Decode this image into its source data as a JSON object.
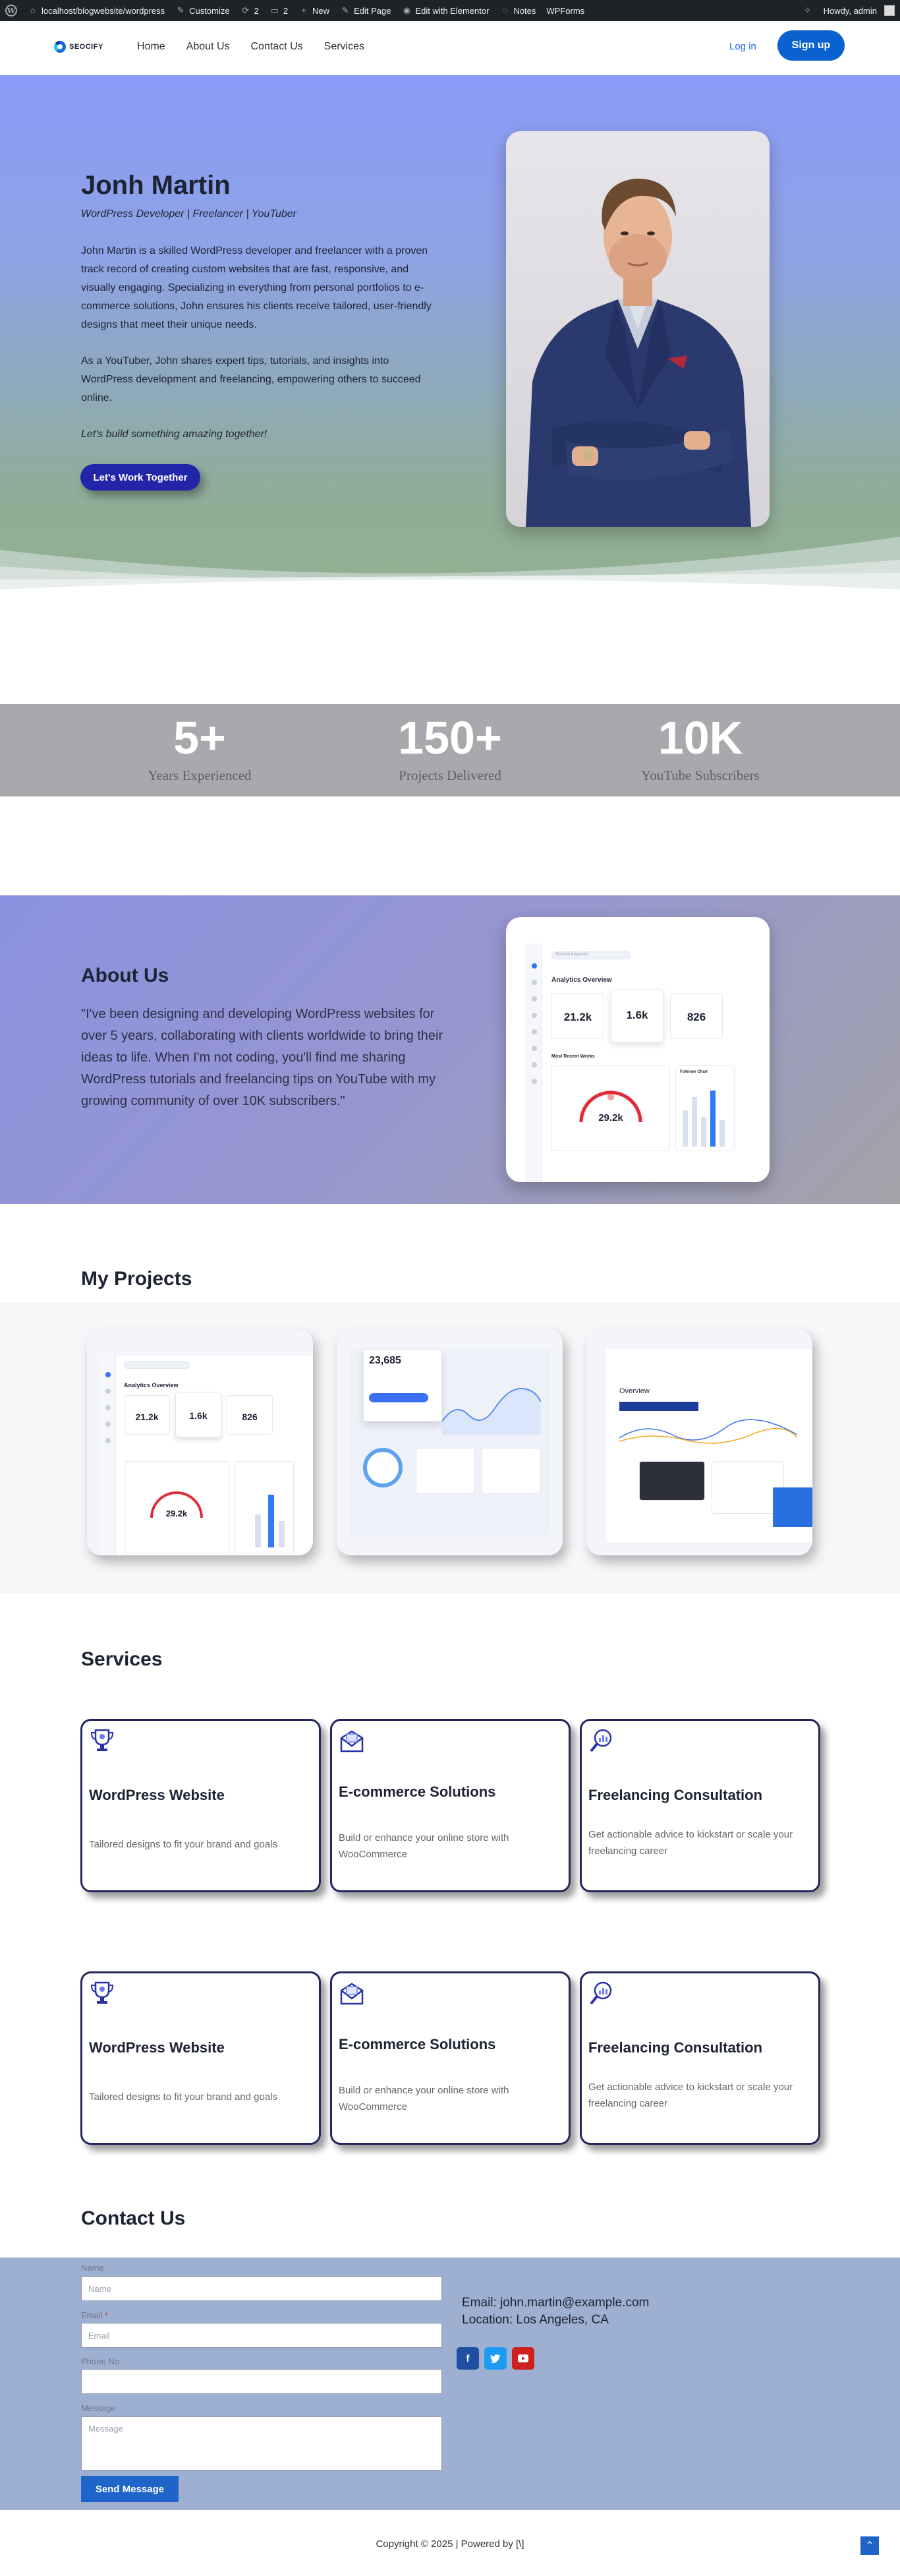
{
  "adminbar": {
    "site": "localhost/blogwebsite/wordpress",
    "customize": "Customize",
    "updates": "2",
    "comments": "2",
    "new": "New",
    "edit_page": "Edit Page",
    "edit_elementor": "Edit with Elementor",
    "notes": "Notes",
    "wpforms": "WPForms",
    "howdy": "Howdy, admin"
  },
  "header": {
    "logo_text": "SEOCIFY",
    "nav": [
      "Home",
      "About Us",
      "Contact Us",
      "Services"
    ],
    "login": "Log in",
    "signup": "Sign up"
  },
  "hero": {
    "name": "Jonh Martin",
    "tagline": "WordPress Developer | Freelancer | YouTuber",
    "bio": "John Martin is a skilled WordPress developer and freelancer with a proven track record of creating custom websites that are fast, responsive, and visually engaging. Specializing in everything from personal portfolios to e-commerce solutions, John ensures his clients receive tailored, user-friendly designs that meet their unique needs.",
    "bio2": "As a YouTuber, John shares expert tips, tutorials, and insights into WordPress development and freelancing, empowering others to succeed online.",
    "cta_text": "Let's build something amazing together!",
    "button": "Let's Work Together"
  },
  "stats": [
    {
      "number": "5+",
      "label": "Years Experienced"
    },
    {
      "number": "150+",
      "label": "Projects Delivered"
    },
    {
      "number": "10K",
      "label": "YouTube Subscribers"
    }
  ],
  "about": {
    "title": "About Us",
    "text": "\"I've been designing and developing WordPress websites for over 5 years, collaborating with clients worldwide to bring their ideas to life. When I'm not coding, you'll find me sharing WordPress tutorials and freelancing tips on YouTube with my growing community of over 10K subscribers.\""
  },
  "dashboard_mock": {
    "heading": "Analytics Overview",
    "search": "Search keyword",
    "stats": [
      "21.2k",
      "1.6k",
      "826"
    ],
    "section": "Most Recent Weeks",
    "gauge": "29.2k",
    "panel": "Follower Chart"
  },
  "projects": {
    "title": "My Projects",
    "wallet_value": "23,685",
    "overview": "Overview"
  },
  "services": {
    "title": "Services",
    "items": [
      {
        "title": "WordPress Website",
        "desc": "Tailored designs to fit your brand and goals",
        "icon": "trophy-icon"
      },
      {
        "title": "E-commerce Solutions",
        "desc": "Build or enhance your online store with WooCommerce",
        "icon": "envelope-icon"
      },
      {
        "title": "Freelancing Consultation",
        "desc": "Get actionable advice to kickstart or scale your freelancing career",
        "icon": "analytics-search-icon"
      }
    ]
  },
  "contact": {
    "title": "Contact Us",
    "fields": {
      "name_label": "Name",
      "name_placeholder": "Name",
      "email_label": "Email",
      "email_placeholder": "Email",
      "phone_label": "Phone No",
      "message_label": "Message",
      "message_placeholder": "Message"
    },
    "send": "Send Message",
    "email": "Email: john.martin@example.com",
    "location": "Location: Los Angeles, CA",
    "social": [
      "facebook-icon",
      "twitter-icon",
      "youtube-icon"
    ]
  },
  "footer": {
    "copyright": "Copyright © 2025 | Powered by [\\]"
  },
  "colors": {
    "primary": "#0a62d0",
    "hero_button": "#2325a8",
    "service_border": "#23265e",
    "contact_bg": "#9db0d1",
    "facebook": "#1f4fa0",
    "twitter": "#1d9bf0",
    "youtube": "#cd201f"
  }
}
